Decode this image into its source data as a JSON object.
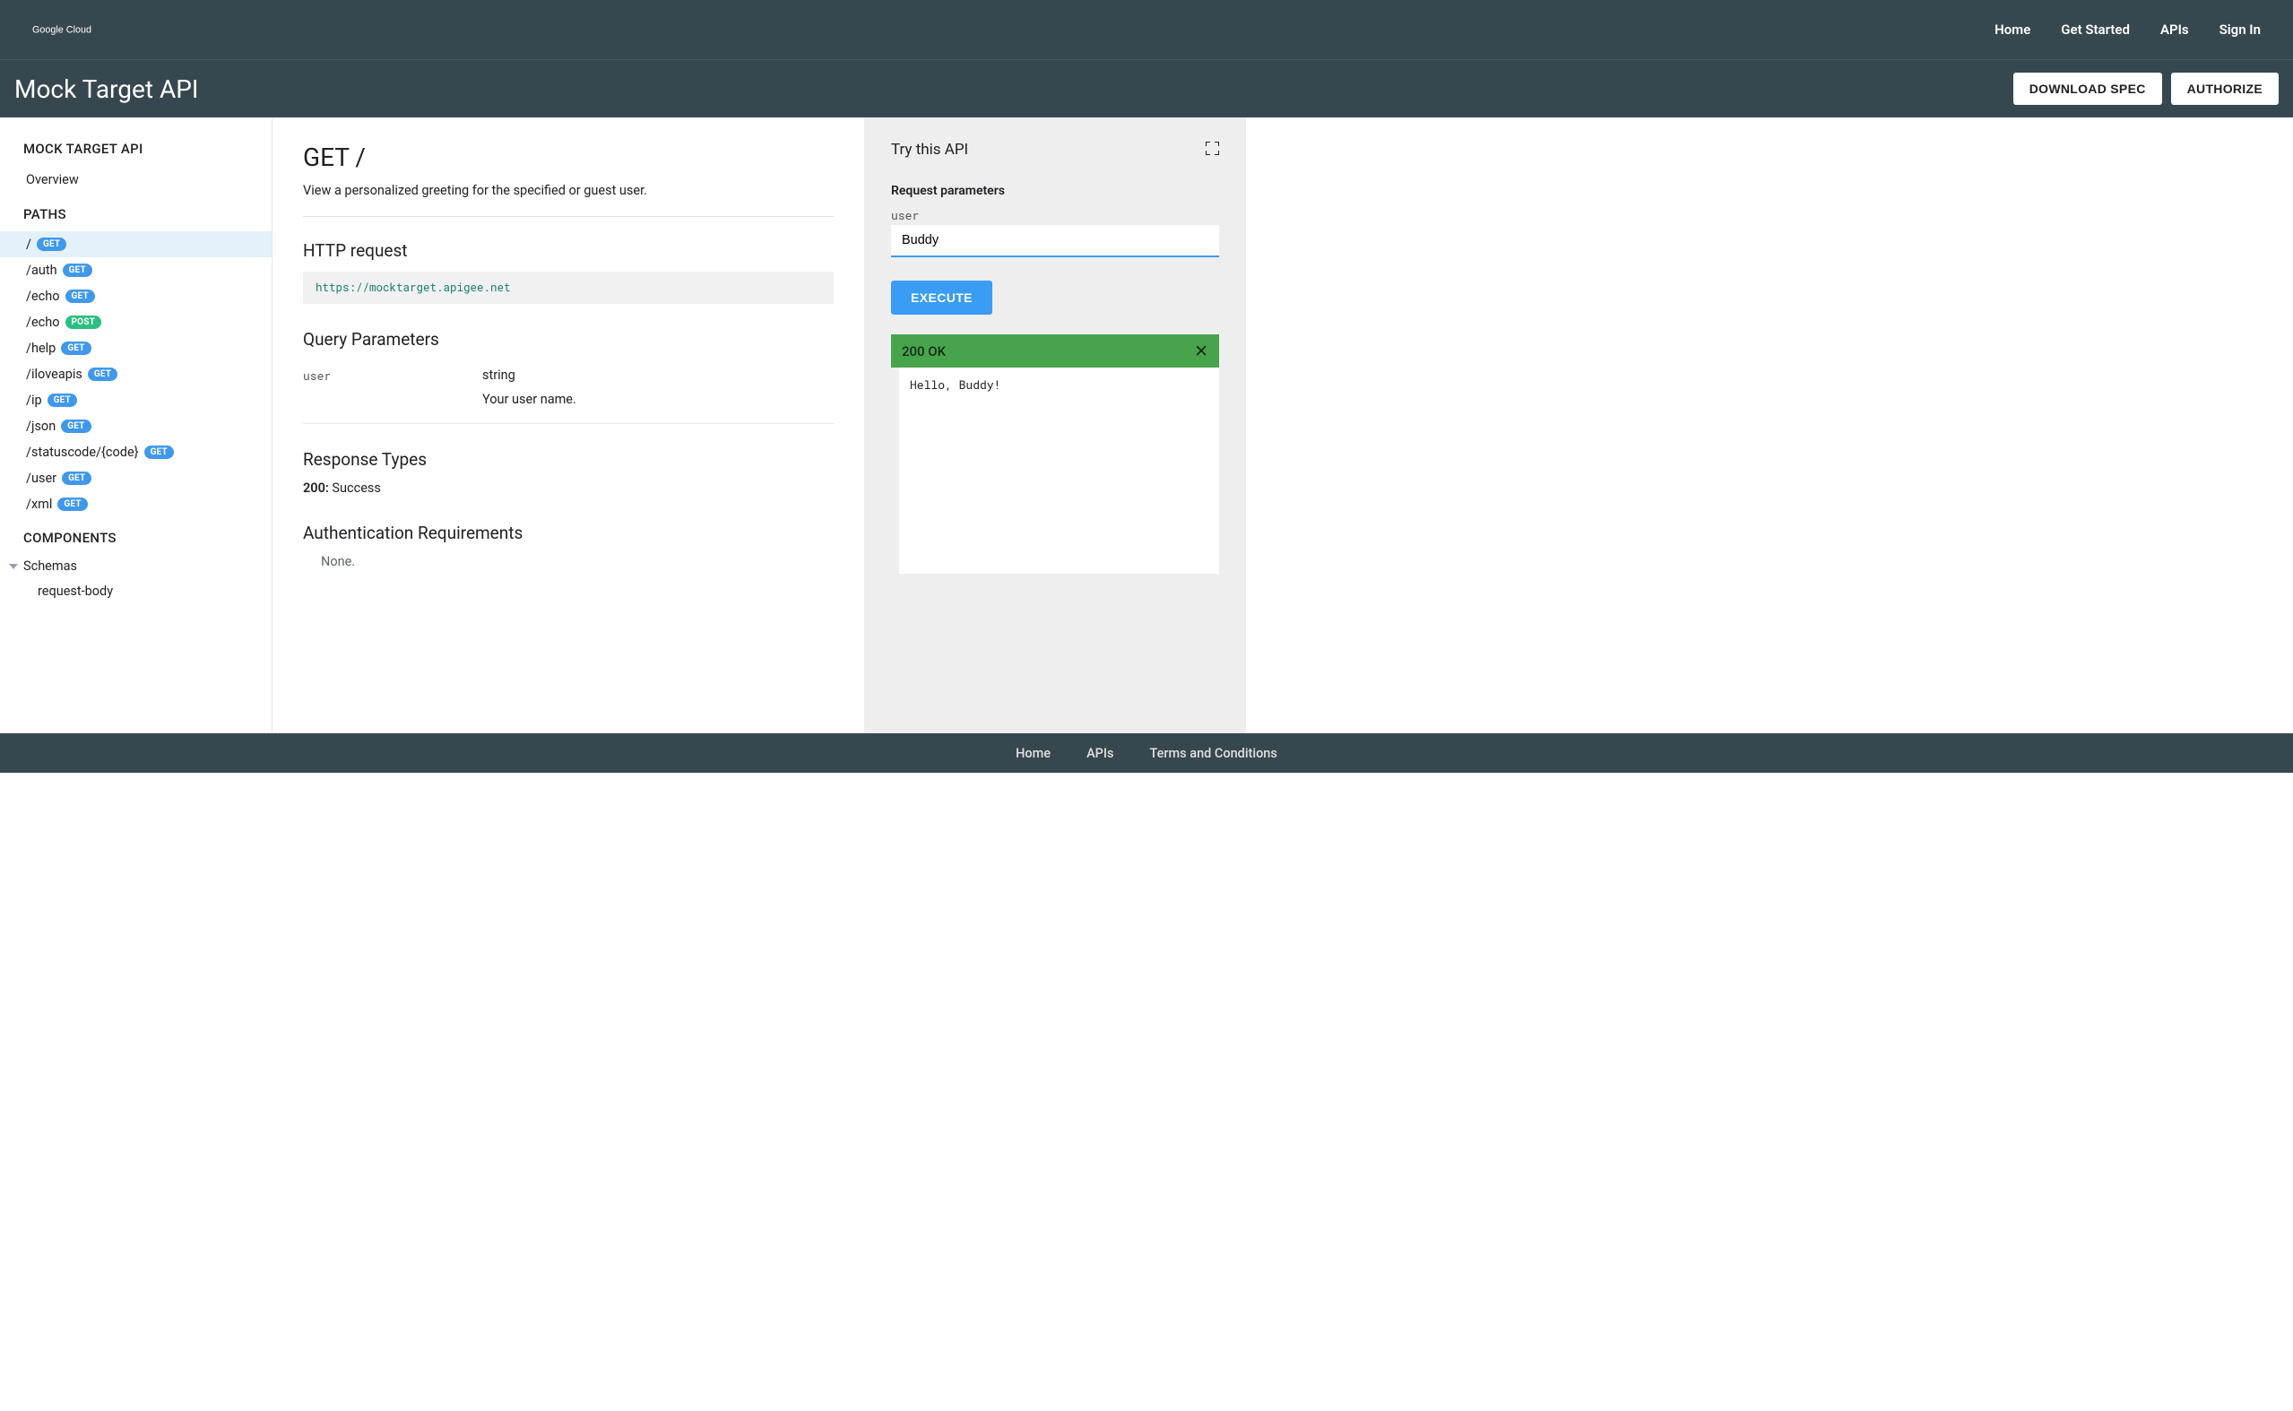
{
  "header": {
    "logo_text": "Google Cloud",
    "nav": {
      "home": "Home",
      "get_started": "Get Started",
      "apis": "APIs",
      "sign_in": "Sign In"
    }
  },
  "sub_header": {
    "title": "Mock Target API",
    "download_spec": "DOWNLOAD SPEC",
    "authorize": "AUTHORIZE"
  },
  "sidebar": {
    "api_heading": "MOCK TARGET API",
    "overview": "Overview",
    "paths_heading": "PATHS",
    "paths": [
      {
        "path": "/",
        "method": "GET",
        "active": true
      },
      {
        "path": "/auth",
        "method": "GET",
        "active": false
      },
      {
        "path": "/echo",
        "method": "GET",
        "active": false
      },
      {
        "path": "/echo",
        "method": "POST",
        "active": false
      },
      {
        "path": "/help",
        "method": "GET",
        "active": false
      },
      {
        "path": "/iloveapis",
        "method": "GET",
        "active": false
      },
      {
        "path": "/ip",
        "method": "GET",
        "active": false
      },
      {
        "path": "/json",
        "method": "GET",
        "active": false
      },
      {
        "path": "/statuscode/{code}",
        "method": "GET",
        "active": false
      },
      {
        "path": "/user",
        "method": "GET",
        "active": false
      },
      {
        "path": "/xml",
        "method": "GET",
        "active": false
      }
    ],
    "components_heading": "COMPONENTS",
    "schemas_label": "Schemas",
    "schemas": [
      "request-body"
    ]
  },
  "content": {
    "title": "GET /",
    "description": "View a personalized greeting for the specified or guest user.",
    "http_request_heading": "HTTP request",
    "http_request_url": "https://mocktarget.apigee.net",
    "query_params_heading": "Query Parameters",
    "params": [
      {
        "name": "user",
        "type": "string",
        "description": "Your user name."
      }
    ],
    "response_types_heading": "Response Types",
    "responses": [
      {
        "code": "200:",
        "text": " Success"
      }
    ],
    "auth_heading": "Authentication Requirements",
    "auth_text": "None."
  },
  "try_panel": {
    "title": "Try this API",
    "request_params_heading": "Request parameters",
    "param_label": "user",
    "param_value": "Buddy",
    "execute_label": "EXECUTE",
    "response_status": "200 OK",
    "response_body": "Hello, Buddy!"
  },
  "footer": {
    "home": "Home",
    "apis": "APIs",
    "terms": "Terms and Conditions"
  }
}
